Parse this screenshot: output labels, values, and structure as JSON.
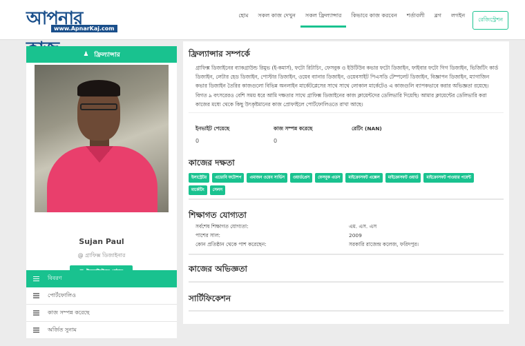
{
  "header": {
    "logo_text": "আপনার কাজ",
    "logo_url": "www.ApnarKaj.com",
    "nav": [
      "হোম",
      "সকল কাজ দেখুন",
      "সকল ফ্রিল্যান্সার",
      "কিভাবে কাজ করবেন",
      "শর্তাবলী",
      "ব্লগ",
      "লগইন"
    ],
    "register_label": "রেজিস্ট্রেশন",
    "accent": "#19c28f"
  },
  "profile": {
    "panel_title": "ফ্রিল্যান্সার",
    "name": "Sujan Paul",
    "role": "@ গ্রাফিক্স ডিজাইনার",
    "invite_label": "ইনভাইটেশন পাঠান"
  },
  "menu": [
    "বিবরণ",
    "পোর্টফোলিও",
    "কাজ সম্পন্ন করেছে",
    "অর্জিত সুনাম"
  ],
  "about": {
    "title": "ফ্রিল্যান্সার সম্পর্কে",
    "text": "গ্রাফিক্স ডিজাইনের ব্যাকগ্রাউন্ড রিমুভ (ই-কমার্স), ফটো রিটাচিং, ফেসবুক ও ইউটিউব কভার ফটো ডিজাইন, ফাইবার ফটো গিগ ডিজাইন, ভিজিটিং কার্ড ডিজাইন, লেটার হেড ডিজাইন, পোস্টার ডিজাইন, ওয়েব ব্যানার ডিজাইন, ওয়েবসাইট পিএসডি টেম্পলেট ডিজাইন, বিজ্ঞাপন ডিজাইন, ম্যাগাজিন কভার ডিজাইন তৈরির কাজগুলো বিভিন্ন অনলাইন মার্কেটপ্লেসের সাথে সাথে লোকাল মার্কেটেও এ কাজগুলি ব্যাপকভাবে করার অভিজ্ঞতা রয়েছে। বিগত ৯ বৎসরেরও বেশি সময় ধরে আমি দক্ষতার সাথে গ্রাফিক্স ডিজাইনের কাজ ক্লায়েন্টদের ডেলিভারি দিয়েছি। আমার ক্লায়েন্টের ডেলিভারি করা কাজের মধ্যে থেকে কিছু উৎকৃষ্টমানের কাজ প্রোফাইলে পোর্টফোলিওতে রাখা আছে।"
  },
  "stats": [
    {
      "label": "ইনভাইট পেয়েছে",
      "value": "0"
    },
    {
      "label": "কাজ সম্পন্ন করেছে",
      "value": "0"
    },
    {
      "label": "রেটিং (NAN)",
      "value": ""
    }
  ],
  "skills": {
    "title": "কাজের দক্ষতা",
    "items": [
      "ইলাস্ট্রেটর",
      "এডোবি ফটোশপ",
      "এমাজন ওয়েব সার্ভিস",
      "ওয়ার্ডপ্রেস",
      "ফেসবুক এডস",
      "মাইক্রোসফট এক্সেল",
      "মাইক্রোসফট ওয়ার্ড",
      "মাইক্রোসফট পাওয়ার পয়েন্ট",
      "মার্কেটিং",
      "সেলস"
    ]
  },
  "education": {
    "title": "শিক্ষাগত যোগ্যতা",
    "rows": [
      {
        "label": "সর্বশেষ শিক্ষাগত যোগ্যতা:",
        "value": "এম. এস. এস"
      },
      {
        "label": "পাশের সাল:",
        "value": "2009"
      },
      {
        "label": "কোন প্রতিষ্ঠান থেকে পাশ করেছেন:",
        "value": "সরকারি রাজেন্দ্র কলেজ, ফরিদপুর।"
      }
    ]
  },
  "experience": {
    "title": "কাজের অভিজ্ঞতা"
  },
  "certificate": {
    "title": "সার্টিফিকেশন"
  }
}
